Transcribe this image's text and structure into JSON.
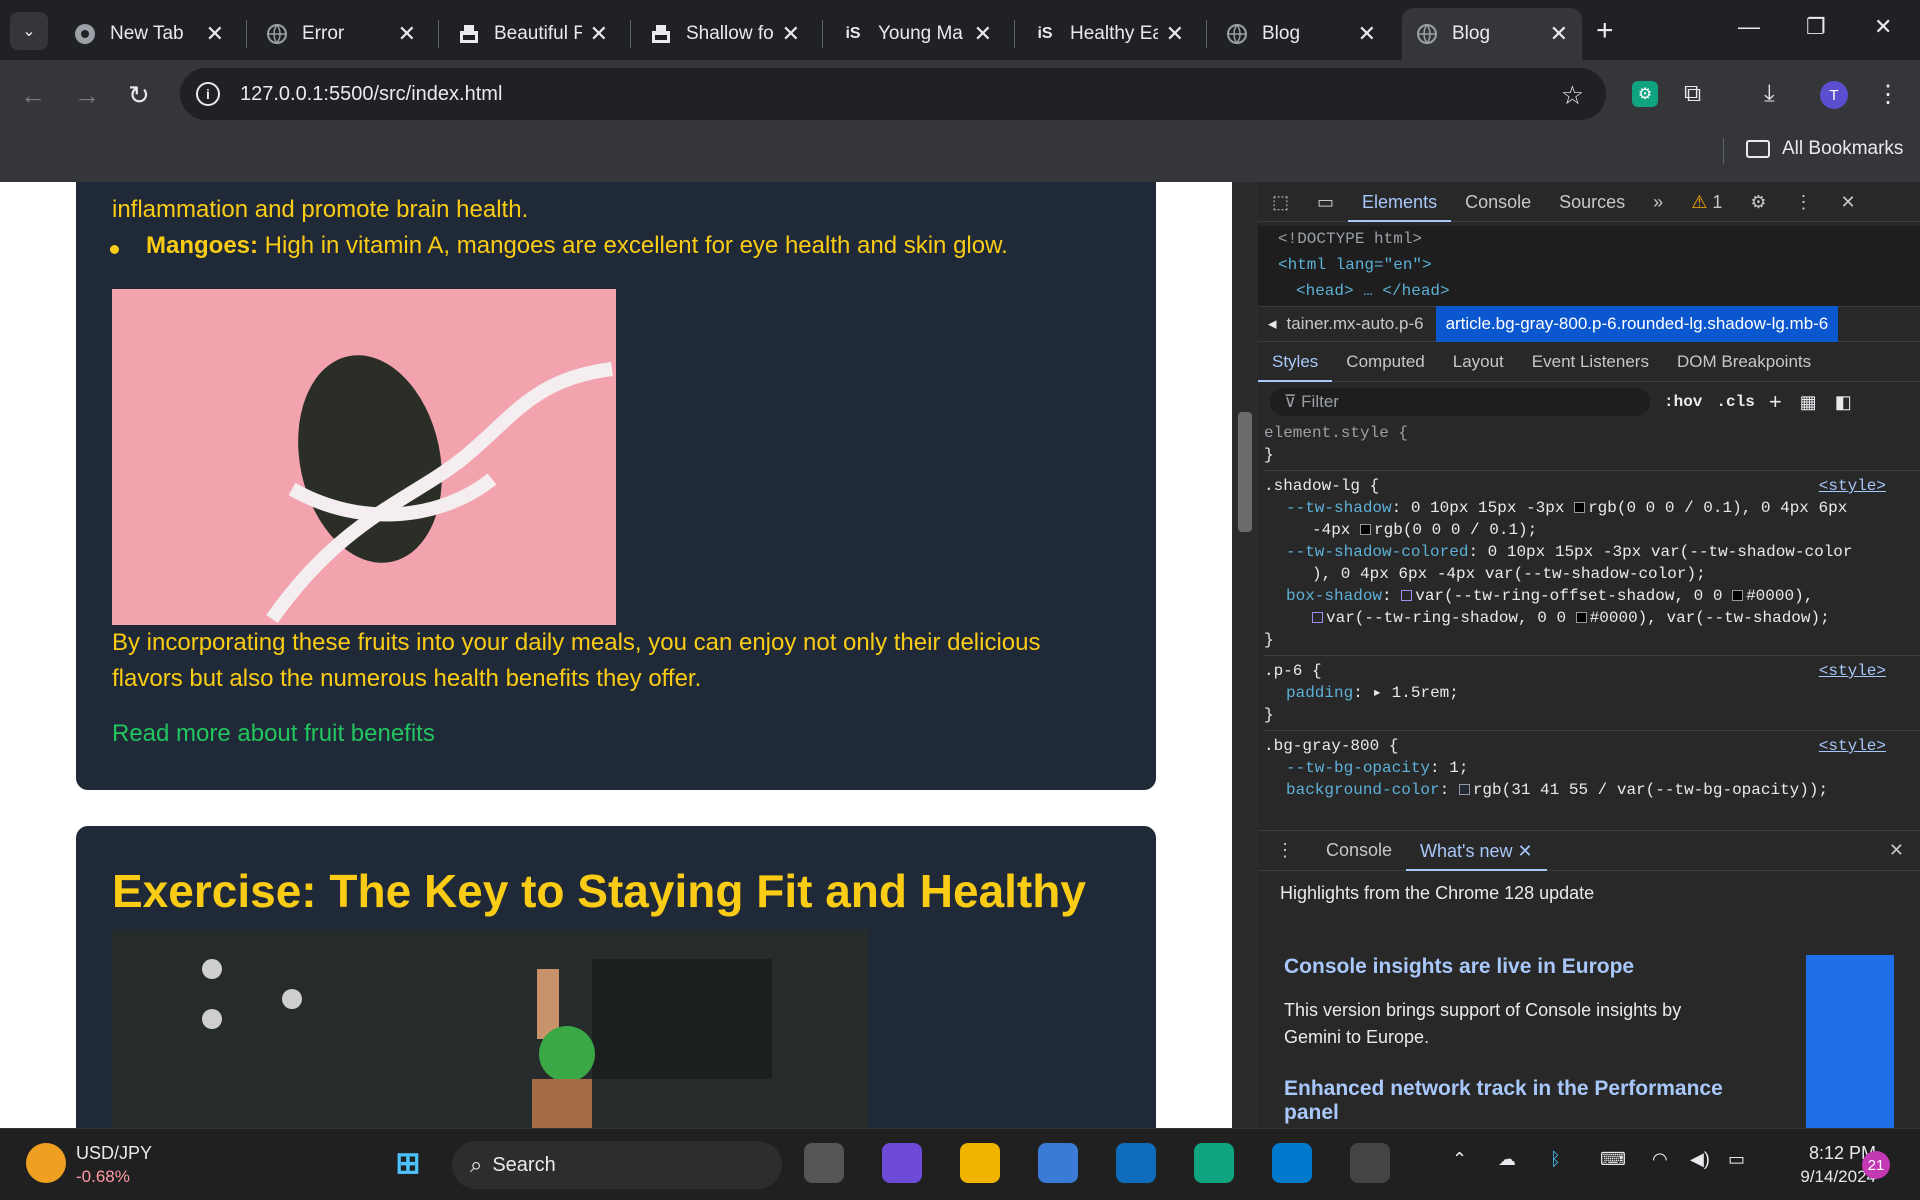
{
  "tabs": [
    {
      "title": "New Tab",
      "icon": "chrome-icon"
    },
    {
      "title": "Error",
      "icon": "globe-icon"
    },
    {
      "title": "Beautiful F",
      "icon": "site-icon"
    },
    {
      "title": "Shallow fo",
      "icon": "site-icon"
    },
    {
      "title": "Young Ma",
      "icon": "is-icon"
    },
    {
      "title": "Healthy Ea",
      "icon": "is-icon"
    },
    {
      "title": "Blog",
      "icon": "globe-icon"
    },
    {
      "title": "Blog",
      "icon": "globe-icon"
    }
  ],
  "omnibox": {
    "url": "127.0.0.1:5500/src/index.html"
  },
  "bookmarks": {
    "label": "All Bookmarks"
  },
  "profile": {
    "initial": "T"
  },
  "article1": {
    "line_partial": "inflammation and promote brain health.",
    "bullet_bold": "Mangoes:",
    "bullet_text": " High in vitamin A, mangoes are excellent for eye health and skin glow.",
    "paragraph_l1": "By incorporating these fruits into your daily meals, you can enjoy not only their delicious",
    "paragraph_l2": "flavors but also the numerous health benefits they offer.",
    "link": "Read more about fruit benefits"
  },
  "article2": {
    "heading": "Exercise: The Key to Staying Fit and Healthy"
  },
  "devtools": {
    "tabs": [
      "Elements",
      "Console",
      "Sources"
    ],
    "warnings": "1",
    "dom": [
      "<!DOCTYPE html>",
      "<html lang=\"en\">",
      "<head> … </head>"
    ],
    "crumb_prev": "tainer.mx-auto.p-6",
    "crumb_sel": "article.bg-gray-800.p-6.rounded-lg.shadow-lg.mb-6",
    "subtabs": [
      "Styles",
      "Computed",
      "Layout",
      "Event Listeners",
      "DOM Breakpoints"
    ],
    "filter_placeholder": "Filter",
    "hov": ":hov",
    "cls": ".cls",
    "src": "<style>",
    "rules": {
      "element_style": "element.style {",
      "shadow_sel": ".shadow-lg {",
      "tw_shadow_1": "0 10px 15px -3px",
      "tw_shadow_2": "rgb(0 0 0 / 0.1), 0 4px 6px",
      "tw_shadow_3": "-4px",
      "tw_shadow_4": "rgb(0 0 0 / 0.1);",
      "colored_1": "0 10px 15px -3px var(--tw-shadow-color",
      "colored_2": "), 0 4px 6px -4px var(--tw-shadow-color);",
      "boxshadow_1": "var(--tw-ring-offset-shadow, 0 0",
      "boxshadow_2": "#0000),",
      "boxshadow_3": "var(--tw-ring-shadow, 0 0",
      "boxshadow_4": "#0000), var(--tw-shadow);",
      "p6_sel": ".p-6 {",
      "padding_val": "1.5rem;",
      "bg_sel": ".bg-gray-800 {",
      "bg_opacity": "1;",
      "bg_color": "rgb(31 41 55 / var(--tw-bg-opacity));"
    },
    "drawer": {
      "tabs": [
        "Console",
        "What's new"
      ],
      "title": "Highlights from the Chrome 128 update",
      "h1": "Console insights are live in Europe",
      "p1": "This version brings support of Console insights by Gemini to Europe.",
      "h2": "Enhanced network track in the Performance panel"
    }
  },
  "taskbar": {
    "ticker_name": "USD/JPY",
    "ticker_change": "-0.68%",
    "search": "Search",
    "time": "8:12 PM",
    "date": "9/14/2024",
    "notif": "21"
  },
  "colors": {
    "card": "#1f2937",
    "yellow": "#facc15",
    "link": "#22c55e",
    "devtools_accent": "#a8c7fa"
  }
}
